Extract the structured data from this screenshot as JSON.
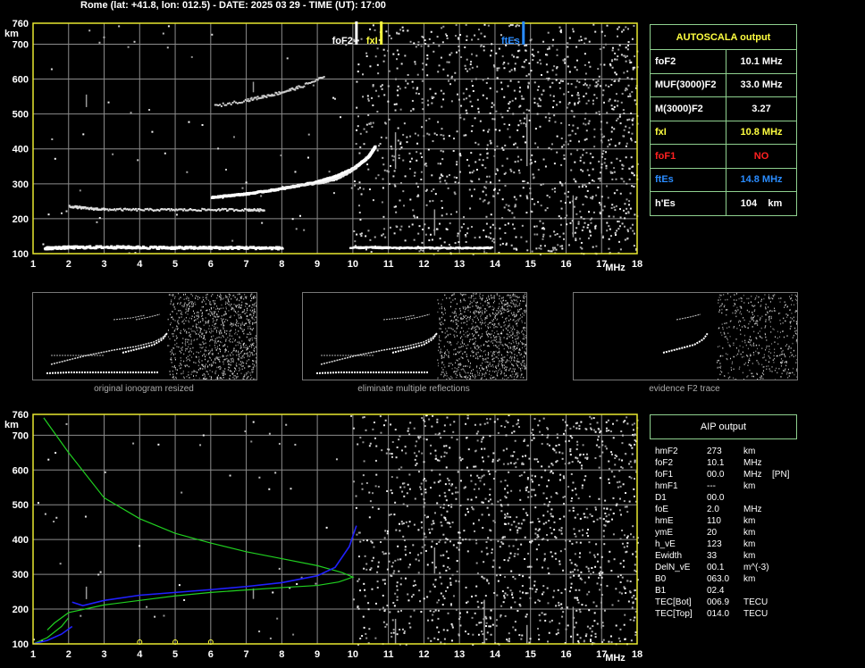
{
  "title": "Rome (lat: +41.8, lon: 012.5) - DATE: 2025 03 29 - TIME (UT): 17:00",
  "colors": {
    "grid": "#8c8c8c",
    "frame": "#e8e830",
    "panel_border": "#8fd08f",
    "yellow": "#ffff40",
    "red": "#ff2020",
    "blue": "#2a8cff",
    "green": "#20d020",
    "trace_blue": "#2020ff"
  },
  "chart_data": [
    {
      "type": "scatter",
      "name_hint": "ionogram-top",
      "xlabel": "MHz",
      "ylabel": "km",
      "xlim": [
        1,
        18
      ],
      "ylim": [
        100,
        760
      ],
      "x_ticks": [
        "1",
        "2",
        "3",
        "4",
        "5",
        "6",
        "7",
        "8",
        "9",
        "10",
        "11",
        "12",
        "13",
        "14",
        "15",
        "16",
        "17",
        "18"
      ],
      "y_ticks": [
        "100",
        "200",
        "300",
        "400",
        "500",
        "600",
        "700",
        "760"
      ],
      "grid": true,
      "markers": [
        {
          "label": "foF2",
          "x": 10.1,
          "color": "#ffffff"
        },
        {
          "label": "fxI",
          "x": 10.8,
          "color": "#ffff40"
        },
        {
          "label": "ftEs",
          "x": 14.8,
          "color": "#2a8cff"
        }
      ],
      "traces": {
        "es_layer": {
          "x": [
            1.3,
            2,
            3,
            4,
            5,
            6,
            7,
            8
          ],
          "y": [
            118,
            120,
            121,
            120,
            119,
            119,
            119,
            118
          ]
        },
        "es_layer_2": {
          "x": [
            9.9,
            10.5,
            11,
            12,
            13,
            13.9
          ],
          "y": [
            119,
            120,
            119,
            119,
            118,
            119
          ]
        },
        "f_low": {
          "x": [
            2,
            2.5,
            3,
            4,
            5,
            6,
            7,
            7.5
          ],
          "y": [
            238,
            232,
            229,
            228,
            228,
            228,
            228,
            227
          ]
        },
        "f2_o": {
          "x": [
            6,
            7,
            8,
            9,
            9.5,
            10,
            10.4,
            10.6
          ],
          "y": [
            265,
            275,
            290,
            310,
            325,
            348,
            380,
            410
          ]
        },
        "f2_x": {
          "x": [
            8,
            9,
            9.5,
            9.8,
            10.1
          ],
          "y": [
            293,
            303,
            315,
            330,
            350
          ]
        },
        "mult": {
          "x": [
            6.1,
            7,
            7.5,
            8,
            8.5,
            9.2
          ],
          "y": [
            525,
            542,
            553,
            565,
            580,
            610
          ]
        }
      }
    },
    {
      "type": "scatter",
      "name_hint": "ionogram-bottom",
      "xlabel": "MHz",
      "ylabel": "km",
      "xlim": [
        1,
        18
      ],
      "ylim": [
        100,
        760
      ],
      "x_ticks": [
        "1",
        "2",
        "3",
        "4",
        "5",
        "6",
        "7",
        "8",
        "9",
        "10",
        "11",
        "12",
        "13",
        "14",
        "15",
        "16",
        "17",
        "18"
      ],
      "y_ticks": [
        "100",
        "200",
        "300",
        "400",
        "500",
        "600",
        "700",
        "760"
      ],
      "grid": true,
      "traces": {
        "green_profile": {
          "x": [
            1.3,
            2,
            3,
            4,
            5,
            6,
            7,
            8,
            9,
            9.7,
            10,
            9.6,
            9,
            8,
            7,
            6,
            5,
            4,
            3,
            2,
            1.6,
            1.4
          ],
          "y": [
            750,
            650,
            520,
            460,
            418,
            390,
            365,
            345,
            325,
            305,
            292,
            278,
            268,
            262,
            255,
            248,
            238,
            225,
            212,
            190,
            160,
            140
          ]
        },
        "green_low": {
          "x": [
            1,
            1.4,
            1.8,
            2.0
          ],
          "y": [
            100,
            118,
            150,
            175
          ]
        },
        "blue_profile": {
          "x": [
            2.1,
            2.4,
            3,
            4,
            5,
            6,
            7,
            8,
            9,
            9.5,
            9.9,
            10.1
          ],
          "y": [
            220,
            210,
            225,
            240,
            248,
            256,
            265,
            276,
            296,
            320,
            380,
            440
          ]
        },
        "blue_low": {
          "x": [
            1,
            1.4,
            1.8,
            2.1
          ],
          "y": [
            100,
            110,
            128,
            150
          ]
        },
        "yellow_dots": {
          "x": [
            4,
            5,
            6
          ],
          "y": [
            100,
            100,
            100
          ]
        }
      }
    }
  ],
  "autoscala": {
    "header": "AUTOSCALA output",
    "rows": [
      {
        "key": "foF2",
        "value": "10.1 MHz",
        "color": "#ffffff"
      },
      {
        "key": "MUF(3000)F2",
        "value": "33.0 MHz",
        "color": "#ffffff"
      },
      {
        "key": "M(3000)F2",
        "value": "3.27",
        "color": "#ffffff"
      },
      {
        "key": "fxI",
        "value": "10.8 MHz",
        "color": "#ffff40"
      },
      {
        "key": "foF1",
        "value": "NO",
        "color": "#ff2020"
      },
      {
        "key": "ftEs",
        "value": "14.8 MHz",
        "color": "#2a8cff"
      },
      {
        "key": "h'Es",
        "value": "104    km",
        "color": "#ffffff"
      }
    ]
  },
  "thumbnails": [
    {
      "caption": "original ionogram resized"
    },
    {
      "caption": "eliminate multiple reflections"
    },
    {
      "caption": "evidence F2 trace"
    }
  ],
  "aip": {
    "header": "AIP output",
    "rows": [
      {
        "k": "hmF2",
        "v": "273",
        "u": "km",
        "x": ""
      },
      {
        "k": "foF2",
        "v": "10.1",
        "u": "MHz",
        "x": ""
      },
      {
        "k": "foF1",
        "v": "00.0",
        "u": "MHz",
        "x": "[PN]"
      },
      {
        "k": "hmF1",
        "v": "---",
        "u": "km",
        "x": ""
      },
      {
        "k": "D1",
        "v": "00.0",
        "u": "",
        "x": ""
      },
      {
        "k": "foE",
        "v": "2.0",
        "u": "MHz",
        "x": ""
      },
      {
        "k": "hmE",
        "v": "110",
        "u": "km",
        "x": ""
      },
      {
        "k": "ymE",
        "v": "20",
        "u": "km",
        "x": ""
      },
      {
        "k": "h_vE",
        "v": "123",
        "u": "km",
        "x": ""
      },
      {
        "k": "Ewidth",
        "v": "33",
        "u": "km",
        "x": ""
      },
      {
        "k": "DelN_vE",
        "v": "00.1",
        "u": "m^(-3)",
        "x": ""
      },
      {
        "k": "B0",
        "v": "063.0",
        "u": "km",
        "x": ""
      },
      {
        "k": "B1",
        "v": "02.4",
        "u": "",
        "x": ""
      },
      {
        "k": "TEC[Bot]",
        "v": "006.9",
        "u": "TECU",
        "x": ""
      },
      {
        "k": "TEC[Top]",
        "v": "014.0",
        "u": "TECU",
        "x": ""
      }
    ]
  }
}
